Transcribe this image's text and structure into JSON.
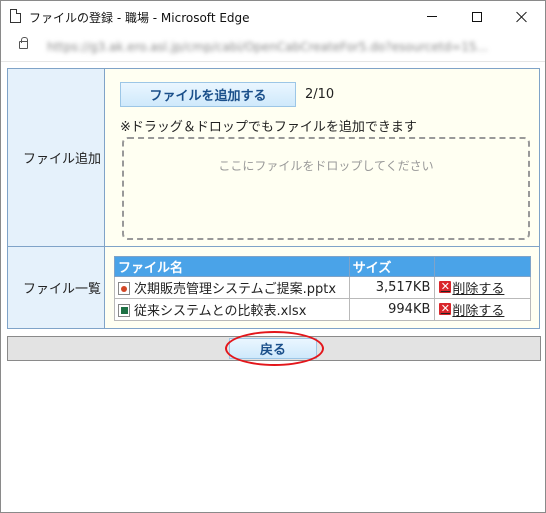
{
  "window": {
    "title": "ファイルの登録 - 職場 - Microsoft Edge",
    "url": "https://g3.ak.ero.asl.jp/cmp/cabi/OpenCabCreateFor5.do?esourcetd=15..."
  },
  "form": {
    "add_label": "ファイル追加",
    "add_button_label": "ファイルを追加する",
    "file_count": "2/10",
    "drag_drop_note": "※ドラッグ＆ドロップでもファイルを追加できます",
    "drop_zone_text": "ここにファイルをドロップしてください",
    "list_label": "ファイル一覧"
  },
  "file_table": {
    "headers": {
      "name": "ファイル名",
      "size": "サイズ",
      "action": ""
    },
    "rows": [
      {
        "icon": "pptx-file-icon",
        "name": "次期販売管理システムご提案.pptx",
        "size": "3,517KB",
        "delete_label": "削除する"
      },
      {
        "icon": "xlsx-file-icon",
        "name": "従来システムとの比較表.xlsx",
        "size": "994KB",
        "delete_label": "削除する"
      }
    ]
  },
  "footer": {
    "back_button_label": "戻る"
  },
  "colors": {
    "label_bg": "#e5f1fb",
    "value_bg": "#fffff2",
    "header_blue": "#4aa3e8",
    "highlight_red": "#e3161b"
  }
}
